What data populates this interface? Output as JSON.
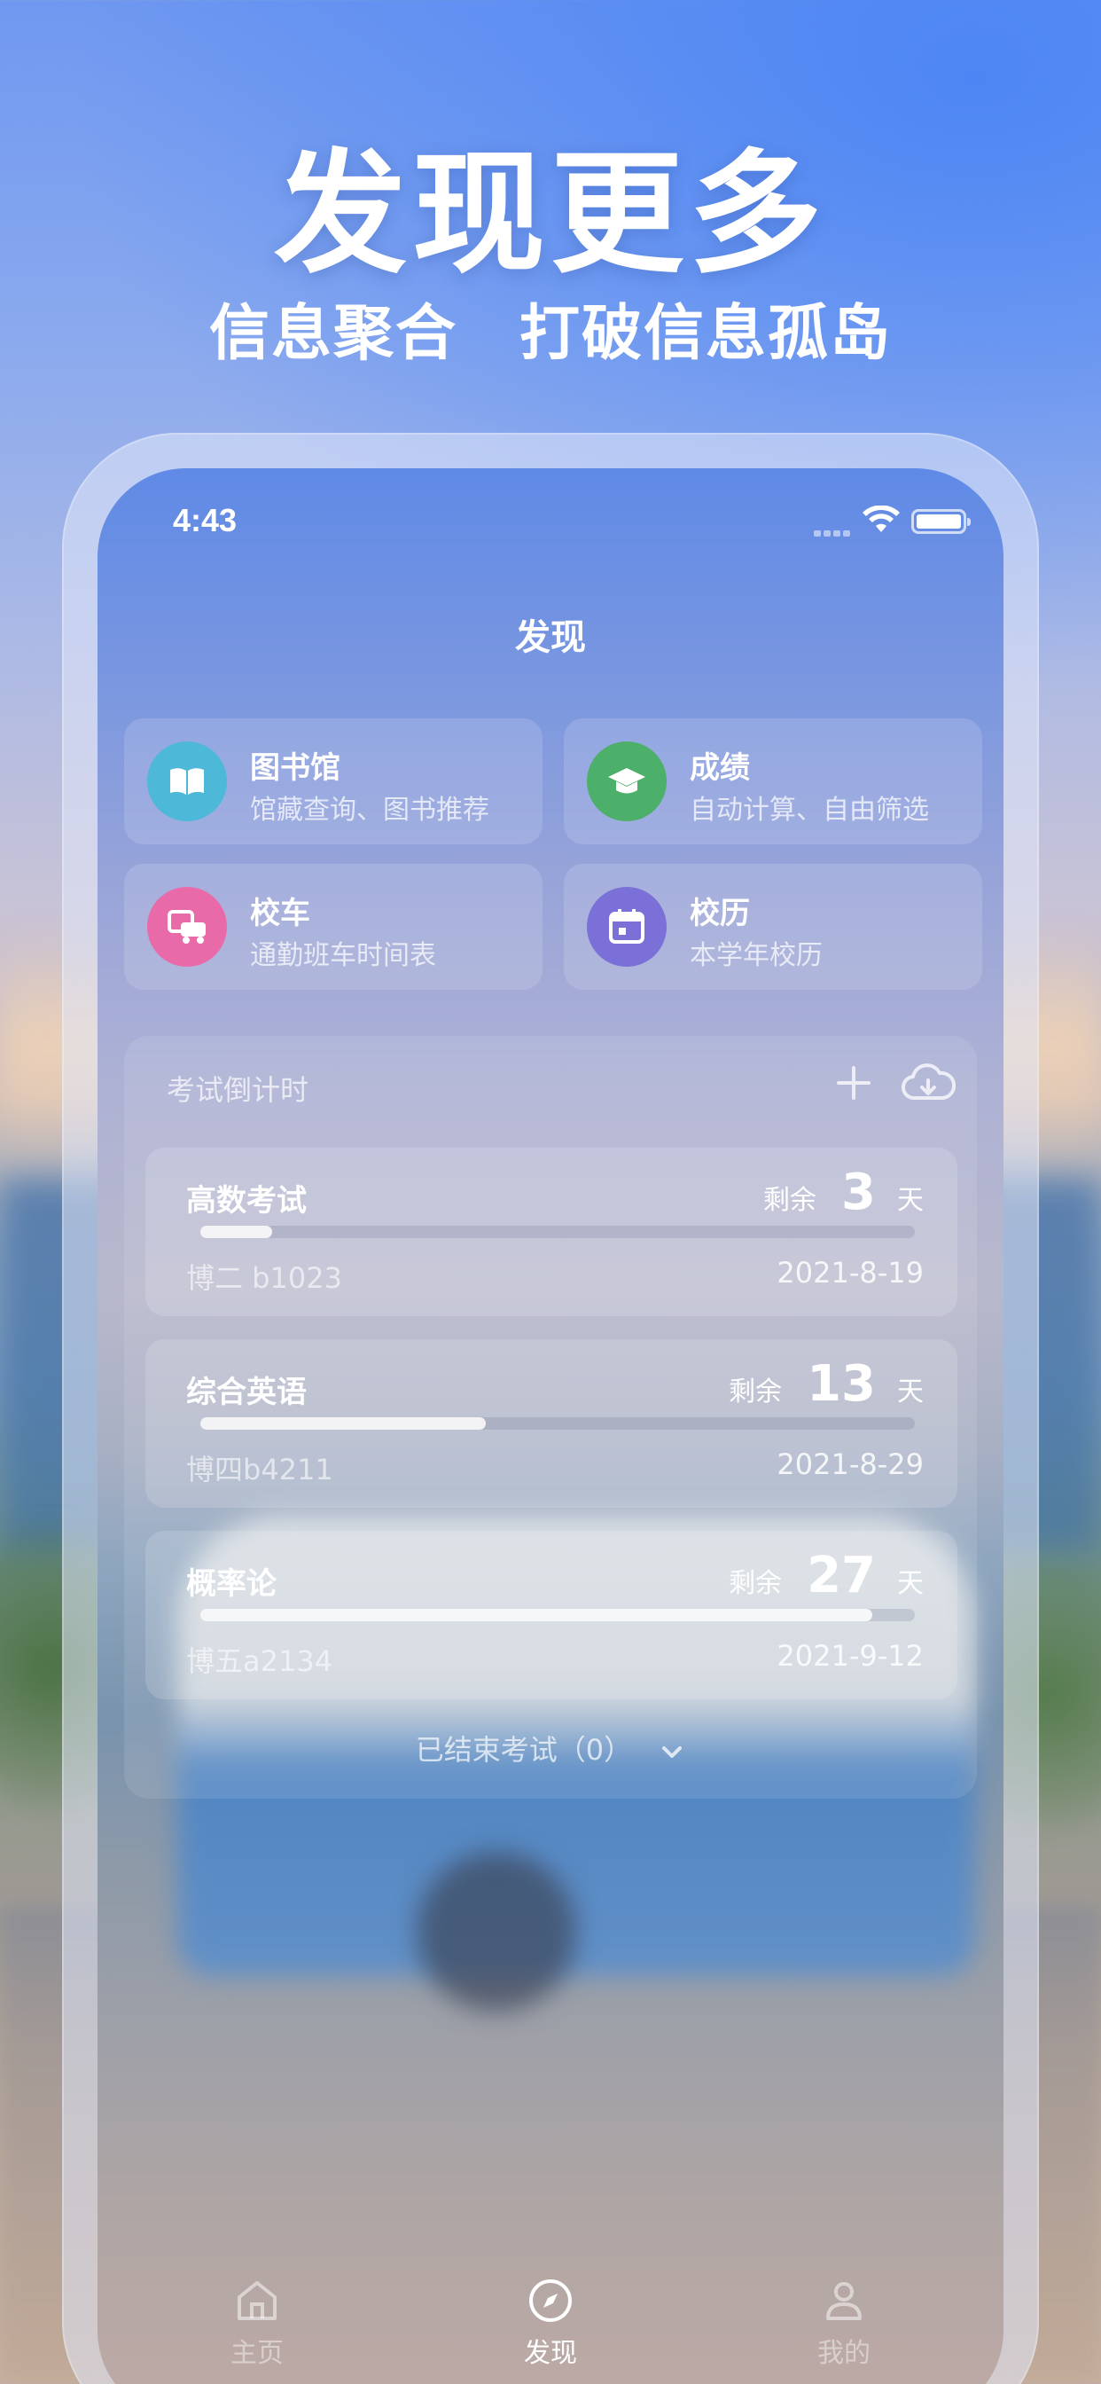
{
  "promo": {
    "headline": "发现更多",
    "subline": "信息聚合　打破信息孤岛"
  },
  "status_bar": {
    "time": "4:43"
  },
  "nav": {
    "title": "发现"
  },
  "features": [
    {
      "title": "图书馆",
      "subtitle": "馆藏查询、图书推荐",
      "icon": "book-icon",
      "color": "#4db8d8"
    },
    {
      "title": "成绩",
      "subtitle": "自动计算、自由筛选",
      "icon": "graduation-cap-icon",
      "color": "#4caf6a"
    },
    {
      "title": "校车",
      "subtitle": "通勤班车时间表",
      "icon": "bus-icon",
      "color": "#e96aa8"
    },
    {
      "title": "校历",
      "subtitle": "本学年校历",
      "icon": "calendar-icon",
      "color": "#7b6fd8"
    }
  ],
  "exam_countdown": {
    "title": "考试倒计时",
    "exams": [
      {
        "name": "高数考试",
        "remain_label": "剩余",
        "days": "3",
        "unit": "天",
        "room": "博二 b1023",
        "date": "2021-8-19",
        "progress": 0.1
      },
      {
        "name": "综合英语",
        "remain_label": "剩余",
        "days": "13",
        "unit": "天",
        "room": "博四b4211",
        "date": "2021-8-29",
        "progress": 0.4
      },
      {
        "name": "概率论",
        "remain_label": "剩余",
        "days": "27",
        "unit": "天",
        "room": "博五a2134",
        "date": "2021-9-12",
        "progress": 0.94
      }
    ],
    "ended_label": "已结束考试（0）"
  },
  "tabbar": {
    "items": [
      {
        "label": "主页",
        "icon": "home-icon",
        "active": false
      },
      {
        "label": "发现",
        "icon": "compass-icon",
        "active": true
      },
      {
        "label": "我的",
        "icon": "user-icon",
        "active": false
      }
    ]
  }
}
